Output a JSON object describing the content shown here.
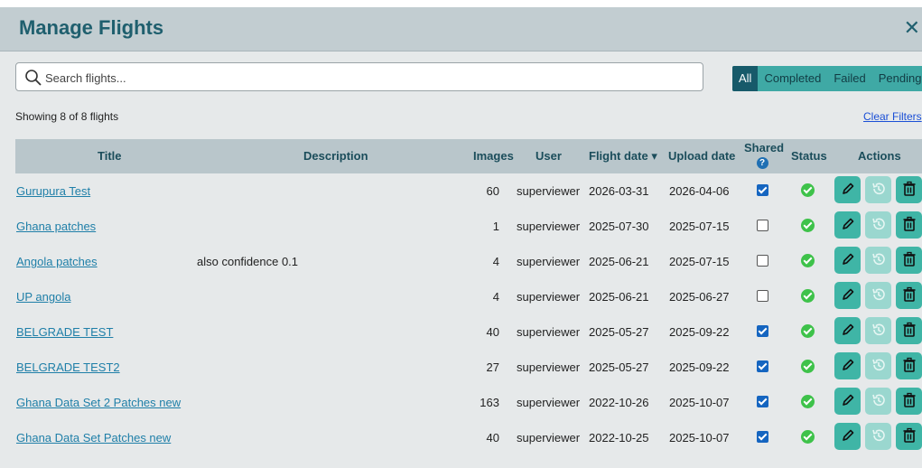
{
  "header": {
    "title": "Manage Flights",
    "close": "✕"
  },
  "search": {
    "placeholder": "Search flights..."
  },
  "filters": [
    "All",
    "Completed",
    "Failed",
    "Pending"
  ],
  "showing": "Showing 8 of 8 flights",
  "clear_filters": "Clear Filters",
  "columns": {
    "title": "Title",
    "description": "Description",
    "images": "Images",
    "user": "User",
    "flight_date": "Flight date ▾",
    "upload_date": "Upload date",
    "shared": "Shared",
    "status": "Status",
    "actions": "Actions"
  },
  "rows": [
    {
      "title": "Gurupura Test",
      "description": "",
      "images": "60",
      "user": "superviewer",
      "flight_date": "2026-03-31",
      "upload_date": "2026-04-06",
      "shared": true
    },
    {
      "title": "Ghana patches",
      "description": "",
      "images": "1",
      "user": "superviewer",
      "flight_date": "2025-07-30",
      "upload_date": "2025-07-15",
      "shared": false
    },
    {
      "title": "Angola patches",
      "description": "also confidence 0.1",
      "images": "4",
      "user": "superviewer",
      "flight_date": "2025-06-21",
      "upload_date": "2025-07-15",
      "shared": false
    },
    {
      "title": "UP angola",
      "description": "",
      "images": "4",
      "user": "superviewer",
      "flight_date": "2025-06-21",
      "upload_date": "2025-06-27",
      "shared": false
    },
    {
      "title": "BELGRADE TEST",
      "description": "",
      "images": "40",
      "user": "superviewer",
      "flight_date": "2025-05-27",
      "upload_date": "2025-09-22",
      "shared": true
    },
    {
      "title": "BELGRADE TEST2",
      "description": "",
      "images": "27",
      "user": "superviewer",
      "flight_date": "2025-05-27",
      "upload_date": "2025-09-22",
      "shared": true
    },
    {
      "title": "Ghana Data Set 2 Patches new",
      "description": "",
      "images": "163",
      "user": "superviewer",
      "flight_date": "2022-10-26",
      "upload_date": "2025-10-07",
      "shared": true
    },
    {
      "title": "Ghana Data Set Patches new",
      "description": "",
      "images": "40",
      "user": "superviewer",
      "flight_date": "2022-10-25",
      "upload_date": "2025-10-07",
      "shared": true
    }
  ],
  "icons": {
    "search": "search-icon",
    "edit": "pencil-icon",
    "restore": "history-icon",
    "delete": "trash-icon",
    "status": "check-circle-icon",
    "help": "question-icon"
  },
  "colors": {
    "accent": "#3fb5a6",
    "header_text": "#1f5f6e",
    "filter_active": "#175a6a",
    "status_ok": "#3ec24a",
    "link": "#1f7fa8"
  }
}
